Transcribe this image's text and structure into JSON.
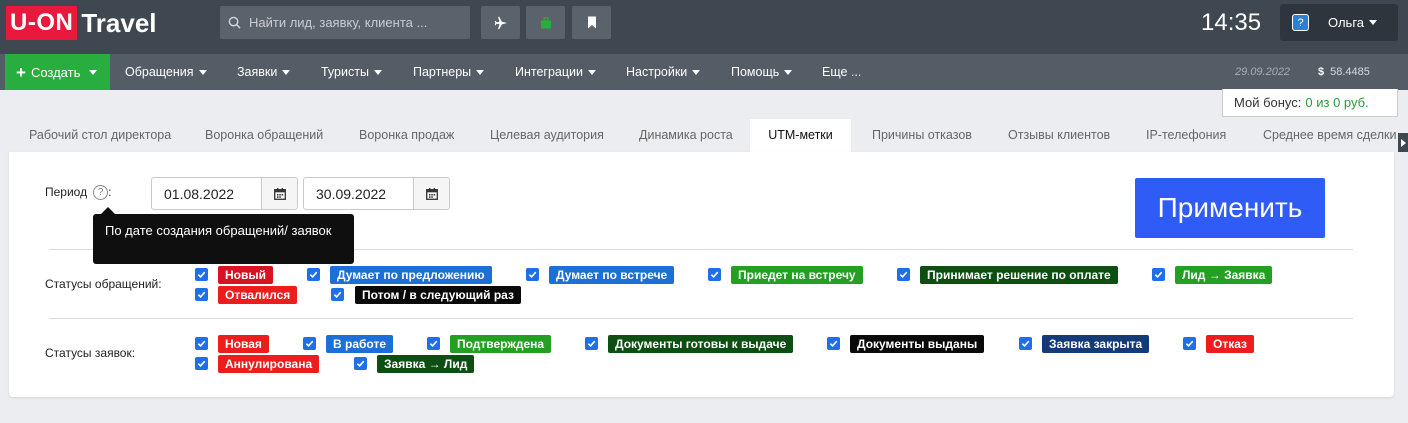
{
  "app": {
    "logo_part1": "U-ON",
    "logo_part2": "Travel"
  },
  "topbar": {
    "search_placeholder": "Найти лид, заявку, клиента ...",
    "time": "14:35",
    "user_name": "Ольга",
    "buttons": [
      "plane-icon",
      "bag-icon",
      "bookmark-icon"
    ]
  },
  "navbar": {
    "create_label": "Создать",
    "items": [
      "Обращения",
      "Заявки",
      "Туристы",
      "Партнеры",
      "Интеграции",
      "Настройки",
      "Помощь",
      "Еще ..."
    ],
    "date": "29.09.2022",
    "currency_symbol": "$",
    "rate": "58.4485"
  },
  "bonus": {
    "label": "Мой бонус:",
    "value": "0 из 0 руб."
  },
  "tabs": [
    "Рабочий стол директора",
    "Воронка обращений",
    "Воронка продаж",
    "Целевая аудитория",
    "Динамика роста",
    "UTM-метки",
    "Причины отказов",
    "Отзывы клиентов",
    "IP-телефония",
    "Среднее время сделки"
  ],
  "active_tab": "UTM-метки",
  "filters": {
    "period_label": "Период",
    "period_help": "?",
    "date_from": "01.08.2022",
    "date_to": "30.09.2022",
    "tooltip": "По дате создания обращений/ заявок",
    "apply_label": "Применить",
    "inquiry_statuses_label": "Статусы обращений:",
    "order_statuses_label": "Статусы заявок:",
    "inquiry_statuses": [
      {
        "label": "Новый",
        "color": "#d9121f",
        "checked": true
      },
      {
        "label": "Думает по предложению",
        "color": "#1c6fd6",
        "checked": true
      },
      {
        "label": "Думает по встрече",
        "color": "#1c6fd6",
        "checked": true
      },
      {
        "label": "Приедет на встречу",
        "color": "#23a022",
        "checked": true
      },
      {
        "label": "Принимает решение по оплате",
        "color": "#0d4f12",
        "checked": true
      },
      {
        "label": "Лид → Заявка",
        "color": "#23a022",
        "checked": true
      },
      {
        "label": "Отвалился",
        "color": "#ee1d1d",
        "checked": true
      },
      {
        "label": "Потом / в следующий раз",
        "color": "#0a0a0a",
        "checked": true
      }
    ],
    "order_statuses": [
      {
        "label": "Новая",
        "color": "#ee1d1d",
        "checked": true
      },
      {
        "label": "В работе",
        "color": "#1c6fd6",
        "checked": true
      },
      {
        "label": "Подтверждена",
        "color": "#23a022",
        "checked": true
      },
      {
        "label": "Документы готовы к выдаче",
        "color": "#0d4f12",
        "checked": true
      },
      {
        "label": "Документы выданы",
        "color": "#0a0a0a",
        "checked": true
      },
      {
        "label": "Заявка закрыта",
        "color": "#143a78",
        "checked": true
      },
      {
        "label": "Отказ",
        "color": "#ee1d1d",
        "checked": true
      },
      {
        "label": "Аннулирована",
        "color": "#ee1d1d",
        "checked": true
      },
      {
        "label": "Заявка → Лид",
        "color": "#0d4f12",
        "checked": true
      }
    ]
  }
}
